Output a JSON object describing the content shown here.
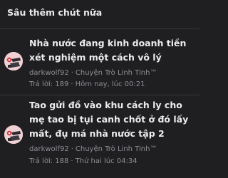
{
  "section": {
    "title": "Sâu thêm chút nữa"
  },
  "threads": [
    {
      "title": "Nhà nước đang kinh doanh tiền xét nghiệm một cách vô lý",
      "author": "darkwolf92",
      "separator": "·",
      "forum": "Chuyện Trò Linh Tinh™",
      "replies": "Trả lời: 189",
      "time": "Hôm nay, lúc 00:21"
    },
    {
      "title": "Tao gửi đồ vào khu cách ly cho mẹ tao bị tụi canh chốt ở đó lấy mất, đụ má nhà nước tập 2",
      "author": "darkwolf92",
      "separator": "·",
      "forum": "Chuyện Trò Linh Tinh™",
      "replies": "Trả lời: 188",
      "time": "Thứ hai lúc 04:34"
    }
  ],
  "colors": {
    "background": "#1f1f22",
    "title_text": "#ececed",
    "meta_text": "#8e8e93",
    "divider": "#38383c",
    "avatar_bg": "#f0d0d3"
  }
}
